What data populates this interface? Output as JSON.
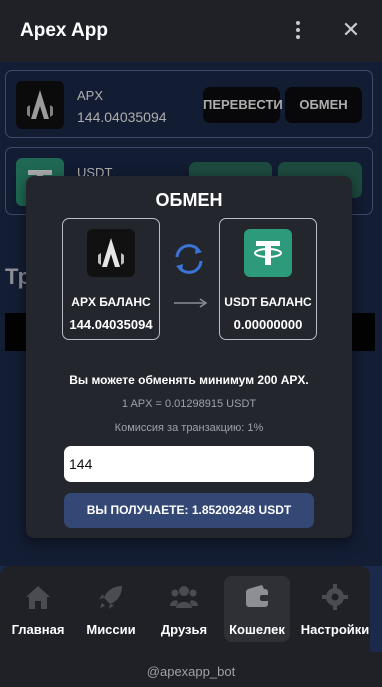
{
  "header": {
    "title": "Apex App",
    "more_icon": "more-vertical-icon",
    "close_icon": "close-icon"
  },
  "wallet": {
    "cards": [
      {
        "name": "APX",
        "balance": "144.04035094",
        "icon": "apx-logo-icon",
        "buttons": [
          "ПЕРЕВЕСТИ",
          "ОБМЕН"
        ]
      },
      {
        "name": "USDT",
        "icon": "tether-logo-icon"
      }
    ],
    "background_heading": "Тр"
  },
  "exchange_modal": {
    "title": "ОБМЕН",
    "from": {
      "label": "APX БАЛАНС",
      "value": "144.04035094",
      "icon": "apx-logo-icon"
    },
    "to": {
      "label": "USDT БАЛАНС",
      "value": "0.00000000",
      "icon": "tether-logo-icon"
    },
    "swap_icon": "swap-arrows-icon",
    "min_note": "Вы можете обменять минимум 200 APX.",
    "rate": "1 APX = 0.01298915 USDT",
    "fee": "Комиссия за транзакцию: 1%",
    "amount_value": "144",
    "receive_label": "ВЫ ПОЛУЧАЕТЕ: 1.85209248 USDT"
  },
  "nav": {
    "items": [
      {
        "label": "Главная",
        "icon": "home-icon",
        "active": false
      },
      {
        "label": "Миссии",
        "icon": "rocket-icon",
        "active": false
      },
      {
        "label": "Друзья",
        "icon": "friends-icon",
        "active": false
      },
      {
        "label": "Кошелек",
        "icon": "wallet-icon",
        "active": true
      },
      {
        "label": "Настройки",
        "icon": "gear-icon",
        "active": false
      }
    ]
  },
  "footer": {
    "bot_handle": "@apexapp_bot"
  },
  "colors": {
    "background": "#1d2b4c",
    "accent_green": "#2e9a7c",
    "modal": "#24262d",
    "receive_button": "#344876"
  }
}
